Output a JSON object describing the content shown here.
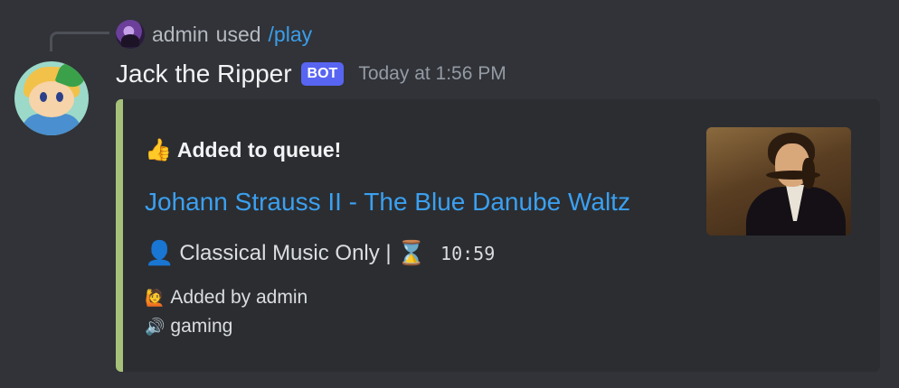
{
  "command": {
    "user": "admin",
    "used_text": "used",
    "name": "/play"
  },
  "author": {
    "name": "Jack the Ripper",
    "badge": "BOT",
    "timestamp": "Today at 1:56 PM"
  },
  "embed": {
    "accent_color": "#a6c17a",
    "title_icon": "👍",
    "title": "Added to queue!",
    "song_title": "Johann Strauss II - The Blue Danube Waltz",
    "channel_icon": "👤",
    "channel_name": "Classical Music Only |",
    "duration_icon": "⌛",
    "duration": "10:59",
    "added_by_icon": "🙋",
    "added_by": "Added by admin",
    "voice_icon": "🔊",
    "voice_channel": "gaming"
  },
  "colors": {
    "background": "#313338",
    "embed_bg": "#2b2d31",
    "link": "#3ba0f0",
    "bot_badge": "#5865f2"
  }
}
